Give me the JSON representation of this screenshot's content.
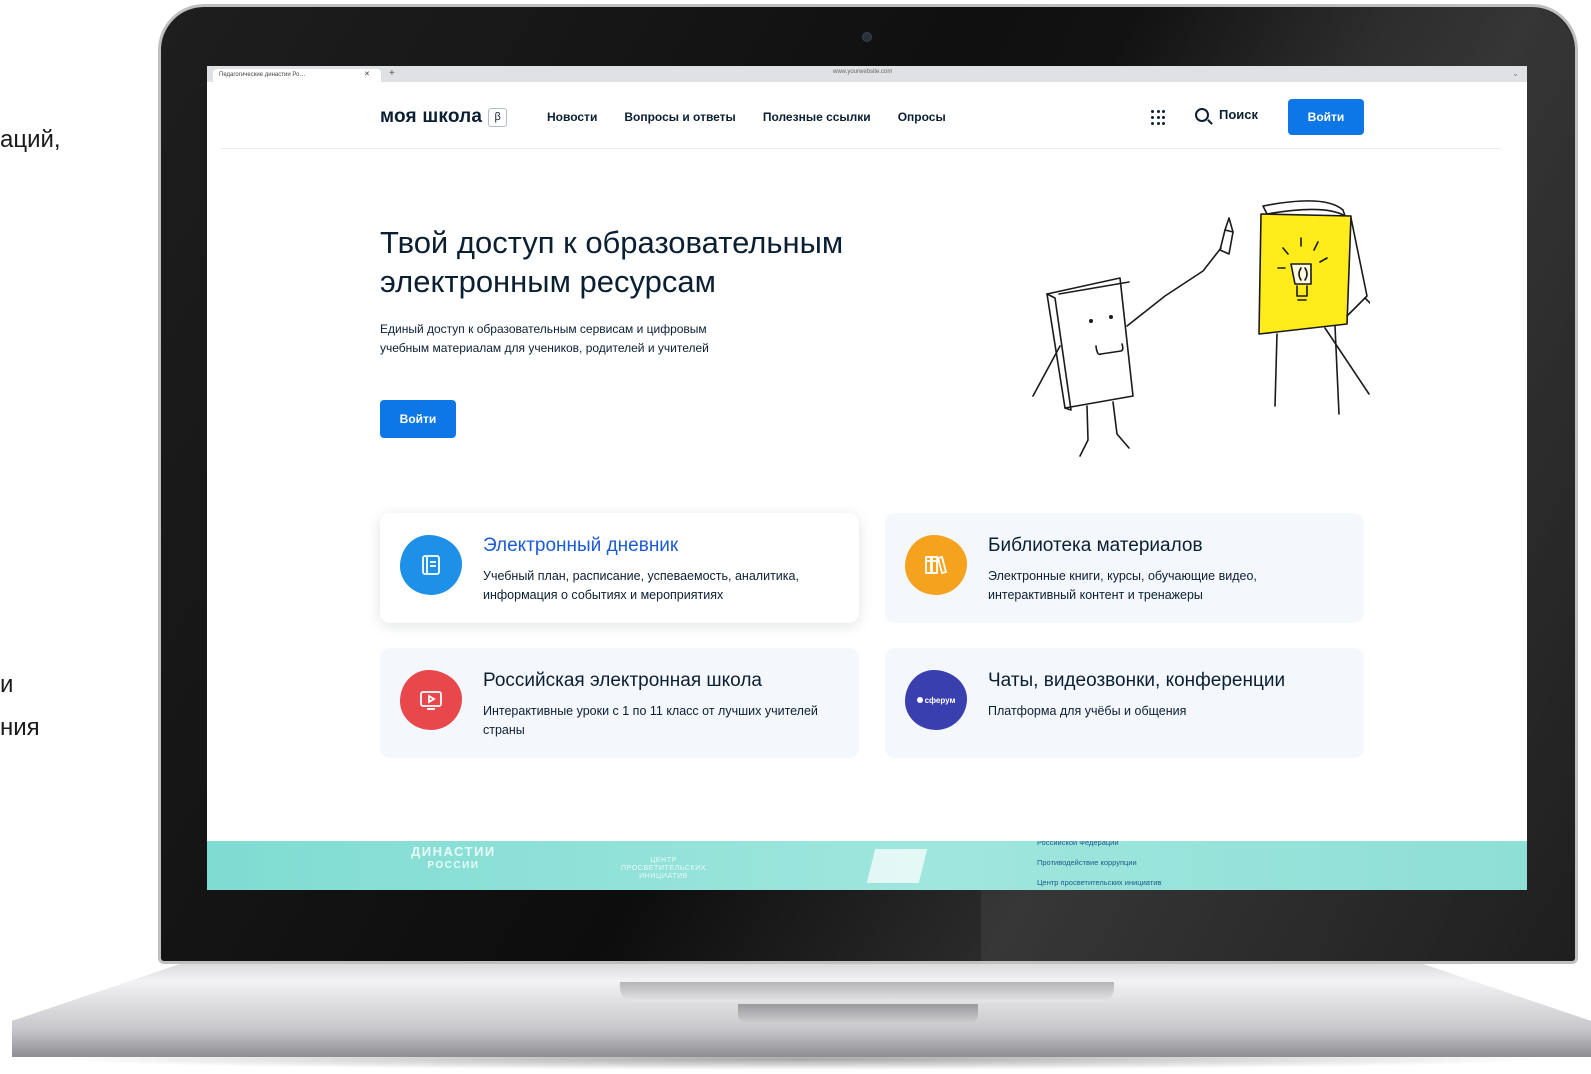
{
  "slide": {
    "fragment_1": "аций,",
    "fragment_2": "и",
    "fragment_3": "ния"
  },
  "browser": {
    "tab_title": "Педагогические династии Ро…",
    "url": "www.yourwebsite.com"
  },
  "header": {
    "logo": "моя школа",
    "beta": "β",
    "nav": [
      "Новости",
      "Вопросы и ответы",
      "Полезные ссылки",
      "Опросы"
    ],
    "search_label": "Поиск",
    "login_label": "Войти"
  },
  "hero": {
    "title": "Твой доступ к образовательным электронным ресурсам",
    "subtitle": "Единый доступ к образовательным сервисам и цифровым учебным материалам для учеников, родителей и учителей",
    "button": "Войти"
  },
  "cards": [
    {
      "title": "Электронный дневник",
      "description": "Учебный план, расписание, успеваемость, аналитика, информация о событиях и мероприятиях",
      "icon": "diary-icon",
      "color": "#1e90e8"
    },
    {
      "title": "Библиотека материалов",
      "description": "Электронные книги, курсы, обучающие видео, интерактивный контент и тренажеры",
      "icon": "library-books-icon",
      "color": "#f5a31f"
    },
    {
      "title": "Российская электронная школа",
      "description": "Интерактивные уроки с 1 по 11 класс от лучших учителей страны",
      "icon": "video-lesson-icon",
      "color": "#e8474c"
    },
    {
      "title": "Чаты, видеозвонки, конференции",
      "description": "Платформа для учёбы и общения",
      "icon": "sferum-logo",
      "icon_label": "сферум",
      "color": "#3a3fb0"
    }
  ],
  "footer": {
    "brand_1": "ДИНАСТИИ",
    "brand_2": "РОССИИ",
    "center_1": "ЦЕНТР",
    "center_2": "ПРОСВЕТИТЕЛЬСКИХ",
    "center_3": "ИНИЦИАТИВ",
    "links": [
      "Российской Федерации",
      "Противодействие коррупции",
      "Центр просветительских инициатив"
    ]
  }
}
